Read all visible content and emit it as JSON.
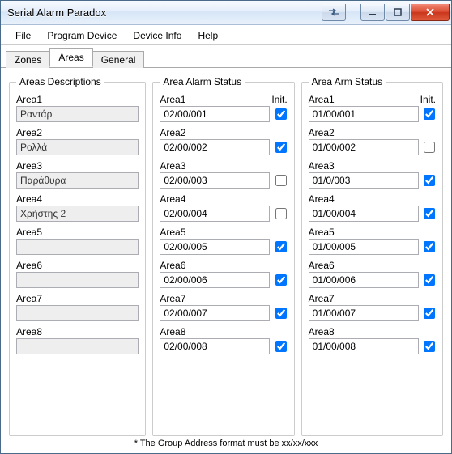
{
  "window": {
    "title": "Serial Alarm Paradox"
  },
  "menu": {
    "file": "File",
    "program": "Program Device",
    "device": "Device Info",
    "help": "Help"
  },
  "tabs": {
    "zones": "Zones",
    "areas": "Areas",
    "general": "General"
  },
  "groups": {
    "desc": "Areas Descriptions",
    "alarm": "Area Alarm Status",
    "arm": "Area Arm Status",
    "init": "Init."
  },
  "desc": [
    {
      "label": "Area1",
      "value": "Ραντάρ"
    },
    {
      "label": "Area2",
      "value": "Ρολλά"
    },
    {
      "label": "Area3",
      "value": "Παράθυρα"
    },
    {
      "label": "Area4",
      "value": "Χρήστης 2"
    },
    {
      "label": "Area5",
      "value": ""
    },
    {
      "label": "Area6",
      "value": ""
    },
    {
      "label": "Area7",
      "value": ""
    },
    {
      "label": "Area8",
      "value": ""
    }
  ],
  "alarm": [
    {
      "label": "Area1",
      "value": "02/00/001",
      "init": true
    },
    {
      "label": "Area2",
      "value": "02/00/002",
      "init": true
    },
    {
      "label": "Area3",
      "value": "02/00/003",
      "init": false
    },
    {
      "label": "Area4",
      "value": "02/00/004",
      "init": false
    },
    {
      "label": "Area5",
      "value": "02/00/005",
      "init": true
    },
    {
      "label": "Area6",
      "value": "02/00/006",
      "init": true
    },
    {
      "label": "Area7",
      "value": "02/00/007",
      "init": true
    },
    {
      "label": "Area8",
      "value": "02/00/008",
      "init": true
    }
  ],
  "arm": [
    {
      "label": "Area1",
      "value": "01/00/001",
      "init": true
    },
    {
      "label": "Area2",
      "value": "01/00/002",
      "init": false
    },
    {
      "label": "Area3",
      "value": "01/0/003",
      "init": true
    },
    {
      "label": "Area4",
      "value": "01/00/004",
      "init": true
    },
    {
      "label": "Area5",
      "value": "01/00/005",
      "init": true
    },
    {
      "label": "Area6",
      "value": "01/00/006",
      "init": true
    },
    {
      "label": "Area7",
      "value": "01/00/007",
      "init": true
    },
    {
      "label": "Area8",
      "value": "01/00/008",
      "init": true
    }
  ],
  "footnote": "* The Group Address format must be xx/xx/xxx"
}
